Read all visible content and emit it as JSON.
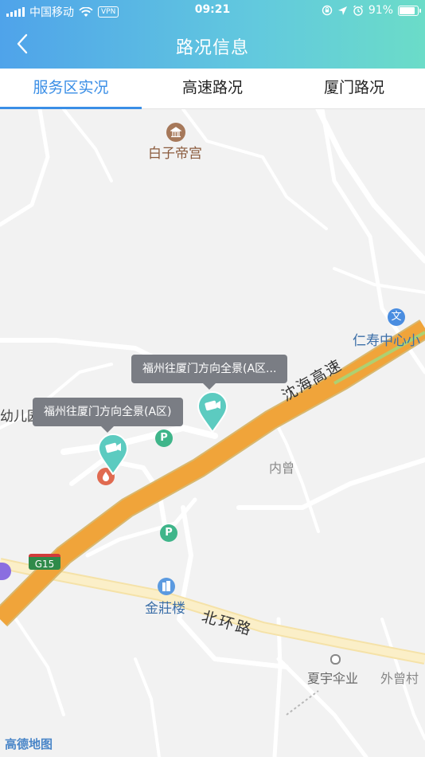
{
  "status": {
    "carrier": "中国移动",
    "vpn": "VPN",
    "time": "09:21",
    "battery": "91%"
  },
  "header": {
    "title": "路况信息"
  },
  "tabs": [
    {
      "label": "服务区实况",
      "active": true
    },
    {
      "label": "高速路况",
      "active": false
    },
    {
      "label": "厦门路况",
      "active": false
    }
  ],
  "map": {
    "places": {
      "baizi": "白子帝宫",
      "renshou": "仁寿中心小",
      "youer": "幼儿园",
      "neizeng": "内曾",
      "jinzhuang": "金莊楼",
      "xiayu": "夏宇伞业",
      "waizeng": "外曾村"
    },
    "roads": {
      "highway": "沈海高速",
      "shield": "G15",
      "beihuan": "北环路"
    },
    "callouts": {
      "camera1": "福州往厦门方向全景(A区...",
      "camera2": "福州往厦门方向全景(A区)"
    },
    "logo": "高德地图"
  },
  "colors": {
    "accent": "#3a8ee6",
    "highway": "#f0a43a",
    "camera_pin": "#5ccbc0"
  }
}
